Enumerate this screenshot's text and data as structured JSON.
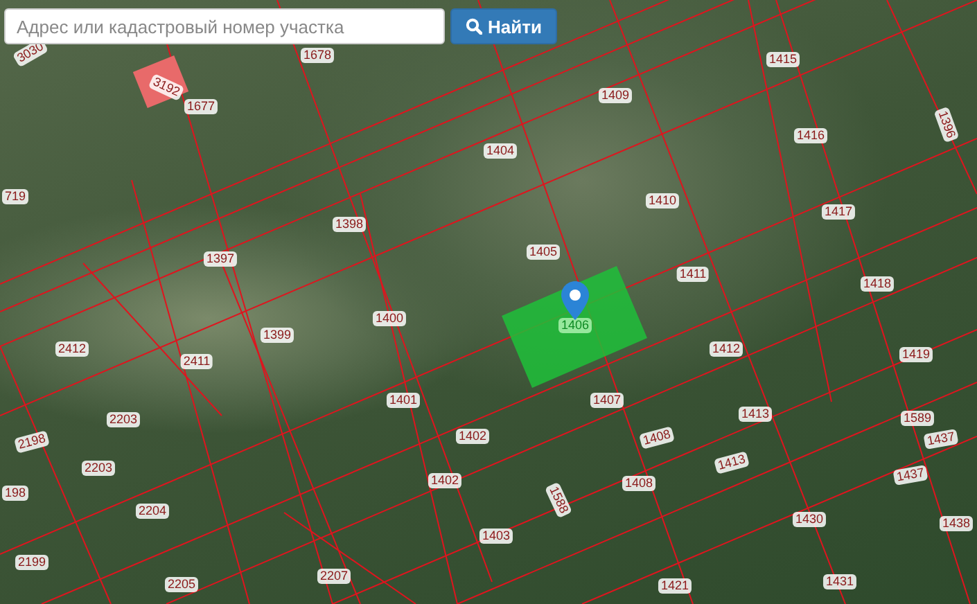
{
  "search": {
    "placeholder": "Адрес или кадастровый номер участка",
    "button": "Найти"
  },
  "map": {
    "parcels": [
      {
        "number": "3030",
        "selected": false
      },
      {
        "number": "1678",
        "selected": false
      },
      {
        "number": "3192",
        "selected": false
      },
      {
        "number": "1677",
        "selected": false
      },
      {
        "number": "719",
        "selected": false
      },
      {
        "number": "1404",
        "selected": false
      },
      {
        "number": "1409",
        "selected": false
      },
      {
        "number": "1415",
        "selected": false
      },
      {
        "number": "1416",
        "selected": false
      },
      {
        "number": "1396",
        "selected": false
      },
      {
        "number": "1410",
        "selected": false
      },
      {
        "number": "1417",
        "selected": false
      },
      {
        "number": "1405",
        "selected": false
      },
      {
        "number": "1411",
        "selected": false
      },
      {
        "number": "1418",
        "selected": false
      },
      {
        "number": "1398",
        "selected": false
      },
      {
        "number": "1397",
        "selected": false
      },
      {
        "number": "1400",
        "selected": false
      },
      {
        "number": "1399",
        "selected": false
      },
      {
        "number": "2412",
        "selected": false
      },
      {
        "number": "2411",
        "selected": false
      },
      {
        "number": "1401",
        "selected": false
      },
      {
        "number": "1406",
        "selected": true
      },
      {
        "number": "1412",
        "selected": false
      },
      {
        "number": "1419",
        "selected": false
      },
      {
        "number": "1407",
        "selected": false
      },
      {
        "number": "1413",
        "selected": false
      },
      {
        "number": "1589",
        "selected": false
      },
      {
        "number": "1437",
        "selected": false
      },
      {
        "number": "1408",
        "selected": false
      },
      {
        "number": "1413",
        "selected": false
      },
      {
        "number": "1408",
        "selected": false
      },
      {
        "number": "1437",
        "selected": false
      },
      {
        "number": "1588",
        "selected": false
      },
      {
        "number": "1430",
        "selected": false
      },
      {
        "number": "1438",
        "selected": false
      },
      {
        "number": "1403",
        "selected": false
      },
      {
        "number": "1421",
        "selected": false
      },
      {
        "number": "1431",
        "selected": false
      },
      {
        "number": "2203",
        "selected": false
      },
      {
        "number": "2198",
        "selected": false
      },
      {
        "number": "2203",
        "selected": false
      },
      {
        "number": "198",
        "selected": false
      },
      {
        "number": "2204",
        "selected": false
      },
      {
        "number": "2199",
        "selected": false
      },
      {
        "number": "2205",
        "selected": false
      },
      {
        "number": "2207",
        "selected": false
      },
      {
        "number": "1402",
        "selected": false
      },
      {
        "number": "1402",
        "selected": false
      }
    ]
  }
}
